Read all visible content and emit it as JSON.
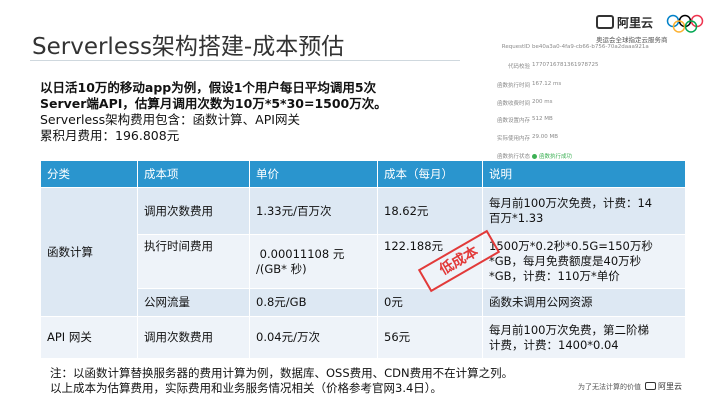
{
  "slide": {
    "title": "Serverless架构搭建-成本预估"
  },
  "brand": {
    "name": "阿里云",
    "subtitle": "奥运会全球指定云服务商",
    "ring_colors": [
      "#0081c8",
      "#000000",
      "#ee334e",
      "#fcb131",
      "#00a651"
    ]
  },
  "function_panel": {
    "rows": [
      {
        "key": "RequestID",
        "value": "be40a3a0-4fa9-cb66-b756-70a2daaa921a"
      },
      {
        "key": "代码校验",
        "value": "1770716781361978725"
      },
      {
        "key": "函数执行时间",
        "value": "167.12 ms"
      },
      {
        "key": "函数收费时间",
        "value": "200 ms"
      },
      {
        "key": "函数设置内存",
        "value": "512 MB"
      },
      {
        "key": "实际使用内存",
        "value": "29.00 MB"
      },
      {
        "key": "函数执行状态",
        "value": "函数执行成功"
      }
    ]
  },
  "intro": {
    "line1": "以日活10万的移动app为例，假设1个用户每日平均调用5次",
    "line2": "Server端API，估算月调用次数为10万*5*30=1500万次。",
    "line3": "Serverless架构费用包含：函数计算、API网关",
    "line4": "累积月费用：196.808元"
  },
  "table": {
    "headers": [
      "分类",
      "成本项",
      "单价",
      "成本（每月）",
      "说明"
    ],
    "group_fc": "函数计算",
    "group_api": "API 网关",
    "rows": [
      {
        "item": "调用次数费用",
        "price": "1.33元/百万次",
        "cost": "18.62元",
        "desc_1": "每月前100万次免费，计费：14",
        "desc_2": "百万*1.33"
      },
      {
        "item": "执行时间费用",
        "price_1": " 0.00011108 元",
        "price_2": "/(GB* 秒)",
        "cost": "122.188元",
        "desc_1": "1500万*0.2秒*0.5G=150万秒",
        "desc_2": "*GB，每月免费额度是40万秒",
        "desc_3": "*GB，计费：110万*单价"
      },
      {
        "item": "公网流量",
        "price": "0.8元/GB",
        "cost": "0元",
        "desc_1": "函数未调用公网资源"
      },
      {
        "item": "调用次数费用",
        "price": "0.04元/万次",
        "cost": "56元",
        "desc_1": "每月前100万次免费，第二阶梯",
        "desc_2": "计费，计费：1400*0.04"
      }
    ]
  },
  "stamp": "低成本",
  "note": {
    "line1": "注：以函数计算替换服务器的费用计算为例，数据库、OSS费用、CDN费用不在计算之列。",
    "line2": "以上成本为估算费用，实际费用和业务服务情况相关（价格参考官网3.4日）。"
  },
  "footer": {
    "slogan": "为了无法计算的价值",
    "brand": "阿里云"
  }
}
